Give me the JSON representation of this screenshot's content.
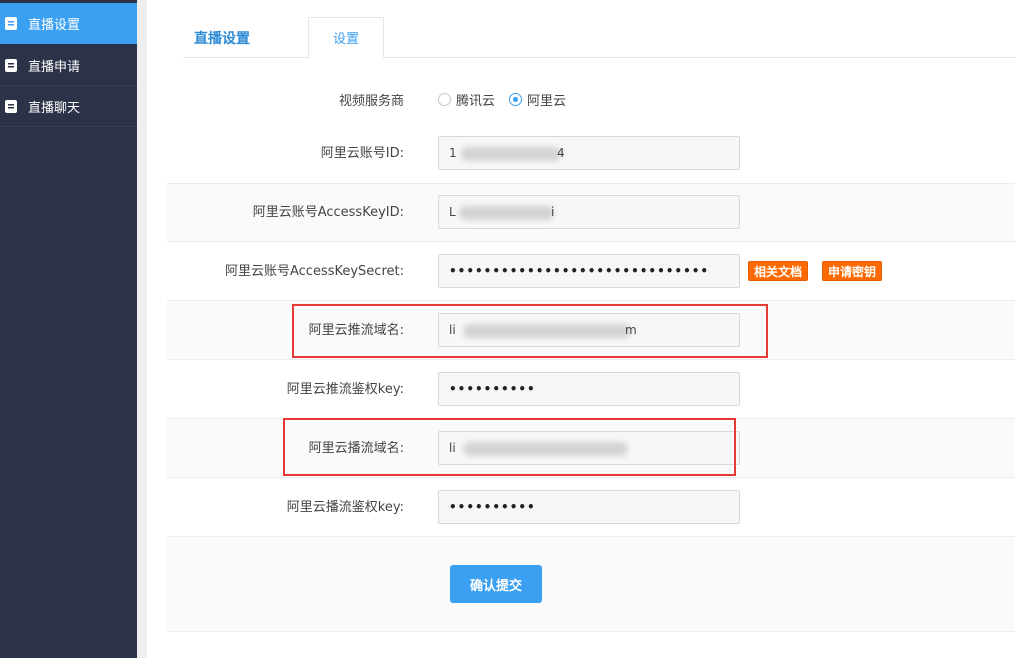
{
  "sidebar": {
    "items": [
      {
        "label": "直播设置",
        "icon": "document-icon",
        "active": true
      },
      {
        "label": "直播申请",
        "icon": "document-icon",
        "active": false
      },
      {
        "label": "直播聊天",
        "icon": "document-icon",
        "active": false
      }
    ]
  },
  "tabs": [
    {
      "label": "直播设置"
    },
    {
      "label": "设置"
    }
  ],
  "form": {
    "provider": {
      "label": "视频服务商",
      "options": [
        {
          "label": "腾讯云",
          "checked": false
        },
        {
          "label": "阿里云",
          "checked": true
        }
      ]
    },
    "account_id": {
      "label": "阿里云账号ID:",
      "value_prefix": "1",
      "value_suffix": "4"
    },
    "access_key_id": {
      "label": "阿里云账号AccessKeyID:",
      "value_prefix": "L",
      "value_suffix": "i"
    },
    "access_key_secret": {
      "label": "阿里云账号AccessKeySecret:",
      "value": "••••••••••••••••••••••••••••••",
      "doc_button": "相关文档",
      "apply_button": "申请密钥"
    },
    "push_domain": {
      "label": "阿里云推流域名:",
      "value_prefix": "li",
      "value_suffix": "m"
    },
    "push_auth_key": {
      "label": "阿里云推流鉴权key:",
      "value": "••••••••••"
    },
    "play_domain": {
      "label": "阿里云播流域名:",
      "value_prefix": "li",
      "value_suffix": ""
    },
    "play_auth_key": {
      "label": "阿里云播流鉴权key:",
      "value": "••••••••••"
    },
    "submit_label": "确认提交"
  },
  "colors": {
    "sidebar_bg": "#2c3247",
    "accent": "#3ba0f1",
    "orange_button": "#ff6a00",
    "highlight_box": "#e53935"
  }
}
